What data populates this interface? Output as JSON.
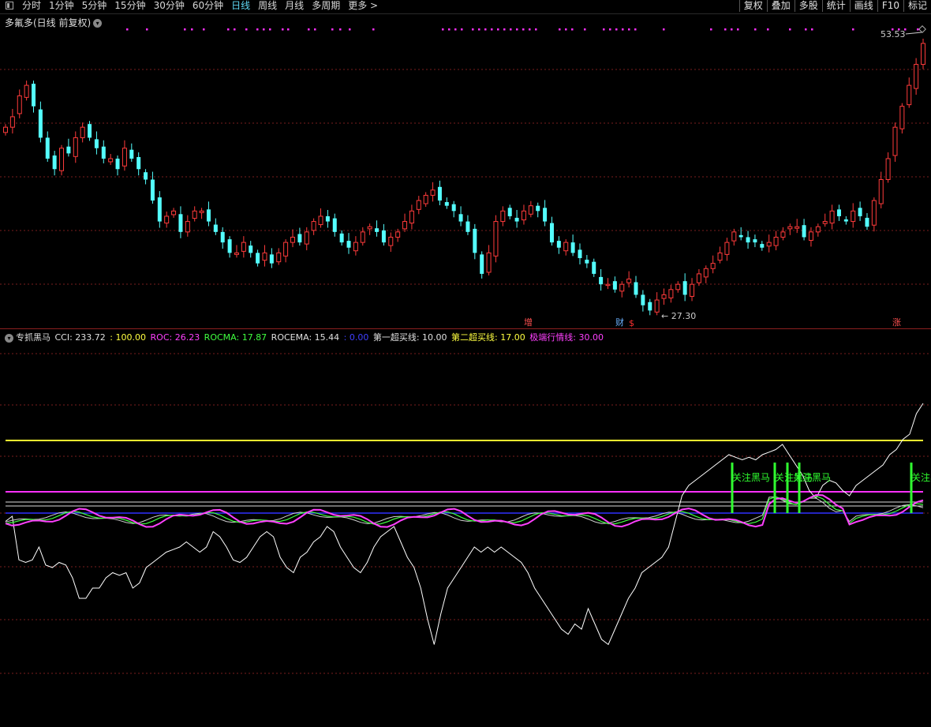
{
  "toolbar": {
    "tabs": [
      "分时",
      "1分钟",
      "5分钟",
      "15分钟",
      "30分钟",
      "60分钟",
      "日线",
      "周线",
      "月线",
      "多周期",
      "更多 >"
    ],
    "active_tab": "日线",
    "right_tabs": [
      "复权",
      "叠加",
      "多股",
      "统计",
      "画线",
      "F10",
      "标记"
    ]
  },
  "price_panel": {
    "title": "多氟多(日线 前复权)",
    "high_label": "53.53",
    "low_label": "27.30",
    "markers": [
      {
        "text": "增",
        "color": "#ff5050"
      },
      {
        "text": "财",
        "color": "#6ab0ff"
      },
      {
        "text": "$",
        "color": "#ff3030"
      },
      {
        "text": "涨",
        "color": "#ff5050"
      }
    ]
  },
  "indicator_panel": {
    "title": "专抓黑马",
    "legend": [
      {
        "label": "CCI: 233.72",
        "color": "#e0e0e0"
      },
      {
        "label": ": 100.00",
        "color": "#ffff40"
      },
      {
        "label": "ROC: 26.23",
        "color": "#ff40ff"
      },
      {
        "label": "ROCMA: 17.87",
        "color": "#40ff40"
      },
      {
        "label": "ROCEMA: 15.44",
        "color": "#e0e0e0"
      },
      {
        "label": ": 0.00",
        "color": "#4040ff"
      },
      {
        "label": "第一超买线: 10.00",
        "color": "#e0e0e0"
      },
      {
        "label": "第二超买线: 17.00",
        "color": "#ffff40"
      },
      {
        "label": "极端行情线: 30.00",
        "color": "#ff40ff"
      }
    ],
    "signal_label": "关注黑马"
  },
  "colors": {
    "up": "#ff3b3b",
    "down": "#54ffff",
    "grid": "#7a1e1e",
    "cci": "#ffffff",
    "roc": "#ff40ff",
    "rocma": "#40ff40",
    "rocema": "#d0d0d0",
    "yellow": "#ffff30",
    "magenta": "#ff30ff",
    "blue": "#3030ff",
    "signal": "#30ff30"
  }
}
